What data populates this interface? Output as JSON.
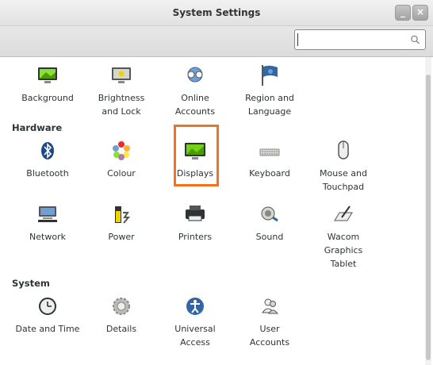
{
  "window": {
    "title": "System Settings",
    "minimize_glyph": "_",
    "close_glyph": "×"
  },
  "search": {
    "value": "",
    "placeholder": "",
    "icon": "search-icon"
  },
  "sections": {
    "personal": {
      "items": [
        {
          "label": "Background",
          "icon": "background-icon"
        },
        {
          "label": "Brightness\nand Lock",
          "icon": "brightness-icon"
        },
        {
          "label": "Online\nAccounts",
          "icon": "online-accounts-icon"
        },
        {
          "label": "Region and\nLanguage",
          "icon": "region-flag-icon"
        }
      ]
    },
    "hardware": {
      "heading": "Hardware",
      "items": [
        {
          "label": "Bluetooth",
          "icon": "bluetooth-icon"
        },
        {
          "label": "Colour",
          "icon": "colour-icon"
        },
        {
          "label": "Displays",
          "icon": "displays-icon"
        },
        {
          "label": "Keyboard",
          "icon": "keyboard-icon"
        },
        {
          "label": "Mouse and\nTouchpad",
          "icon": "mouse-icon"
        },
        {
          "label": "Network",
          "icon": "network-icon"
        },
        {
          "label": "Power",
          "icon": "power-icon"
        },
        {
          "label": "Printers",
          "icon": "printer-icon"
        },
        {
          "label": "Sound",
          "icon": "sound-icon"
        },
        {
          "label": "Wacom\nGraphics\nTablet",
          "icon": "wacom-tablet-icon"
        }
      ]
    },
    "system": {
      "heading": "System",
      "items": [
        {
          "label": "Date and Time",
          "icon": "clock-icon"
        },
        {
          "label": "Details",
          "icon": "details-icon"
        },
        {
          "label": "Universal\nAccess",
          "icon": "universal-access-icon"
        },
        {
          "label": "User\nAccounts",
          "icon": "user-accounts-icon"
        }
      ]
    }
  },
  "colors": {
    "highlight": "#f0741f",
    "accent_blue": "#3465a4"
  }
}
